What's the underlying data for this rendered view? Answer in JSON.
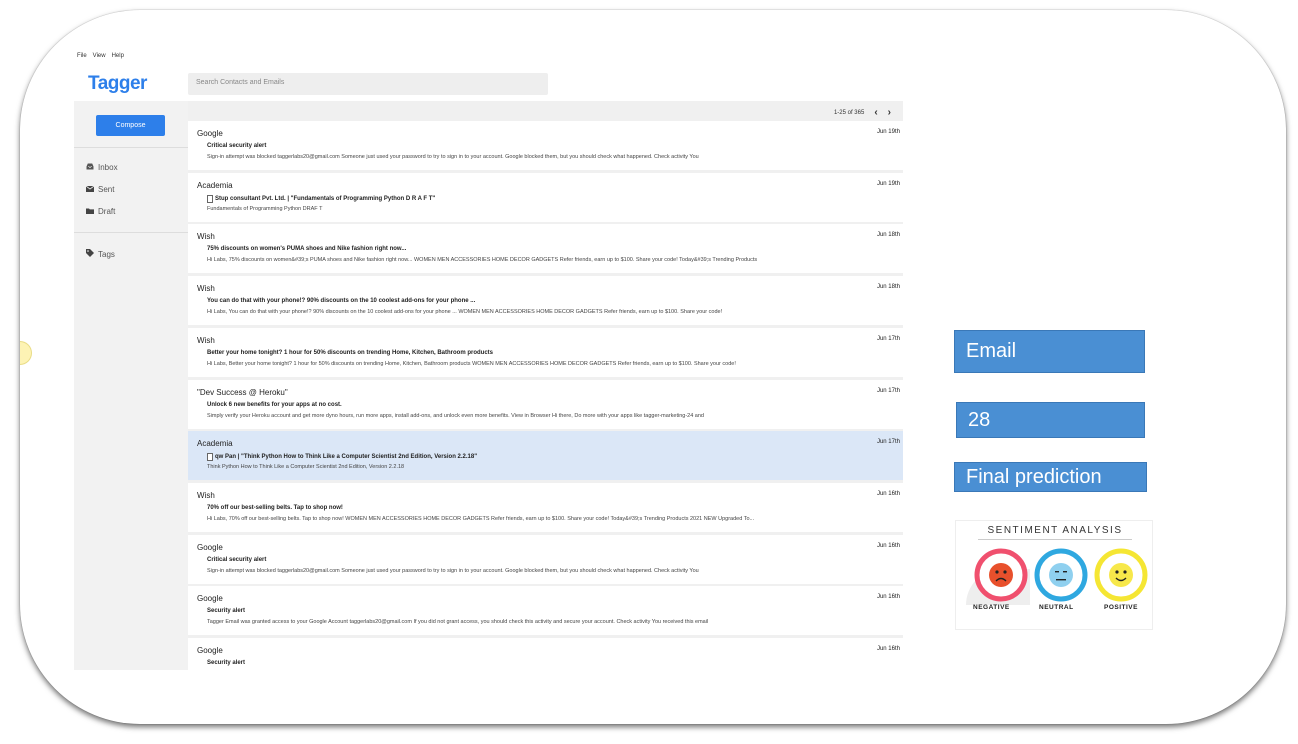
{
  "menu": {
    "file": "File",
    "view": "View",
    "help": "Help"
  },
  "app": {
    "title": "Tagger"
  },
  "search": {
    "placeholder": "Search Contacts and Emails"
  },
  "sidebar": {
    "compose": "Compose",
    "items": [
      {
        "label": "Inbox",
        "icon": "inbox-icon"
      },
      {
        "label": "Sent",
        "icon": "envelope-icon"
      },
      {
        "label": "Draft",
        "icon": "folder-icon"
      }
    ],
    "tags": {
      "label": "Tags",
      "icon": "tag-icon"
    }
  },
  "pager": {
    "range": "1-25 of 365"
  },
  "emails": [
    {
      "sender": "Google",
      "date": "Jun 19th",
      "subject": "Critical security alert",
      "snippet": "Sign-in attempt was blocked taggerlabs20@gmail.com Someone just used your password to try to sign in to your account. Google blocked them, but you should check what happened. Check activity You",
      "has_doc": false
    },
    {
      "sender": "Academia",
      "date": "Jun 19th",
      "subject": "Stup consultant Pvt. Ltd. | \"Fundamentals of Programming Python D R A F T\"",
      "snippet": "Fundamentals of Programming Python DRAF T",
      "has_doc": true
    },
    {
      "sender": "Wish",
      "date": "Jun 18th",
      "subject": "75% discounts on women's PUMA shoes and Nike fashion right now...",
      "snippet": "Hi Labs, 75% discounts on women&#39;s PUMA shoes and Nike fashion right now... WOMEN MEN ACCESSORIES HOME DECOR GADGETS Refer friends, earn up to $100. Share your code! Today&#39;s Trending Products",
      "has_doc": false
    },
    {
      "sender": "Wish",
      "date": "Jun 18th",
      "subject": "You can do that with your phone!? 90% discounts on the 10 coolest add-ons for your phone ...",
      "snippet": "Hi Labs, You can do that with your phone!? 90% discounts on the 10 coolest add-ons for your phone ... WOMEN MEN ACCESSORIES HOME DECOR GADGETS Refer friends, earn up to $100. Share your code!",
      "has_doc": false
    },
    {
      "sender": "Wish",
      "date": "Jun 17th",
      "subject": "Better your home tonight? 1 hour for 50% discounts on trending Home, Kitchen, Bathroom products",
      "snippet": "Hi Labs, Better your home tonight? 1 hour for 50% discounts on trending Home, Kitchen, Bathroom products WOMEN MEN ACCESSORIES HOME DECOR GADGETS Refer friends, earn up to $100. Share your code!",
      "has_doc": false
    },
    {
      "sender": "\"Dev Success @ Heroku\"",
      "date": "Jun 17th",
      "subject": "Unlock 6 new benefits for your apps at no cost.",
      "snippet": "Simply verify your Heroku account and get more dyno hours, run more apps, install add-ons, and unlock even more benefits. View in Browser Hi there, Do more with your apps like tagger-marketing-24 and",
      "has_doc": false
    },
    {
      "sender": "Academia",
      "date": "Jun 17th",
      "subject": "qw Pan | \"Think Python How to Think Like a Computer Scientist 2nd Edition, Version 2.2.18\"",
      "snippet": "Think Python How to Think Like a Computer Scientist 2nd Edition, Version 2.2.18",
      "has_doc": true,
      "selected": true
    },
    {
      "sender": "Wish",
      "date": "Jun 16th",
      "subject": "70% off our best-selling belts. Tap to shop now!",
      "snippet": "Hi Labs, 70% off our best-selling belts. Tap to shop now! WOMEN MEN ACCESSORIES HOME DECOR GADGETS Refer friends, earn up to $100. Share your code! Today&#39;s Trending Products 2021 NEW Upgraded To...",
      "has_doc": false
    },
    {
      "sender": "Google",
      "date": "Jun 16th",
      "subject": "Critical security alert",
      "snippet": "Sign-in attempt was blocked taggerlabs20@gmail.com Someone just used your password to try to sign in to your account. Google blocked them, but you should check what happened. Check activity You",
      "has_doc": false
    },
    {
      "sender": "Google",
      "date": "Jun 16th",
      "subject": "Security alert",
      "snippet": "Tagger Email was granted access to your Google Account taggerlabs20@gmail.com If you did not grant access, you should check this activity and secure your account. Check activity You received this email",
      "has_doc": false
    },
    {
      "sender": "Google",
      "date": "Jun 16th",
      "subject": "Security alert",
      "snippet": "",
      "has_doc": false
    }
  ],
  "panel": {
    "email_label": "Email",
    "count": "28",
    "prediction_label": "Final prediction"
  },
  "sentiment": {
    "title": "SENTIMENT ANALYSIS",
    "negative": "NEGATIVE",
    "neutral": "NEUTRAL",
    "positive": "POSITIVE",
    "negative_color": "#f0506e",
    "neutral_color": "#2fa8e0",
    "positive_color": "#f5e633"
  }
}
